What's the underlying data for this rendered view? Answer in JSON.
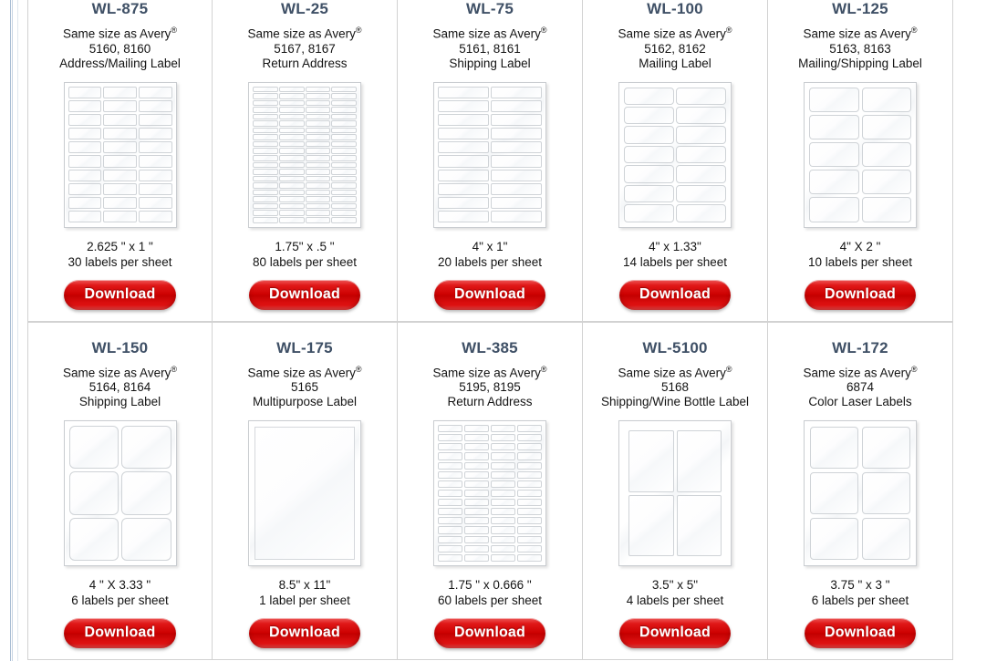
{
  "products": [
    {
      "sku": "WL-875",
      "same_size_as": "Same size as Avery",
      "avery_numbers": "5160, 8160",
      "label_type": "Address/Mailing Label",
      "dimensions": "2.625 \" x 1 \"",
      "count_text": "30 labels per sheet",
      "download_label": "Download",
      "sheet": {
        "cols": 3,
        "rows": 10,
        "gap": 2,
        "radius": "r-sm",
        "pad": 4
      }
    },
    {
      "sku": "WL-25",
      "same_size_as": "Same size as Avery",
      "avery_numbers": "5167, 8167",
      "label_type": "Return Address",
      "dimensions": "1.75\" x .5 \"",
      "count_text": "80 labels per sheet",
      "download_label": "Download",
      "sheet": {
        "cols": 4,
        "rows": 20,
        "gap": 1,
        "radius": "r-sm",
        "pad": 4
      }
    },
    {
      "sku": "WL-75",
      "same_size_as": "Same size as Avery",
      "avery_numbers": "5161, 8161",
      "label_type": "Shipping Label",
      "dimensions": "4\" x 1\"",
      "count_text": "20 labels per sheet",
      "download_label": "Download",
      "sheet": {
        "cols": 2,
        "rows": 10,
        "gap": 2,
        "radius": "r-sm",
        "pad": 4
      }
    },
    {
      "sku": "WL-100",
      "same_size_as": "Same size as Avery",
      "avery_numbers": "5162, 8162",
      "label_type": "Mailing Label",
      "dimensions": "4\" x 1.33\"",
      "count_text": "14 labels per sheet",
      "download_label": "Download",
      "sheet": {
        "cols": 2,
        "rows": 7,
        "gap": 2,
        "radius": "r-md",
        "pad": 5
      }
    },
    {
      "sku": "WL-125",
      "same_size_as": "Same size as Avery",
      "avery_numbers": "5163, 8163",
      "label_type": "Mailing/Shipping Label",
      "dimensions": "4\" X 2 \"",
      "count_text": "10 labels per sheet",
      "download_label": "Download",
      "sheet": {
        "cols": 2,
        "rows": 5,
        "gap": 3,
        "radius": "r-md",
        "pad": 5
      }
    },
    {
      "sku": "WL-150",
      "same_size_as": "Same size as Avery",
      "avery_numbers": "5164, 8164",
      "label_type": "Shipping Label",
      "dimensions": "4 \" X 3.33 \"",
      "count_text": "6 labels per sheet",
      "download_label": "Download",
      "sheet": {
        "cols": 2,
        "rows": 3,
        "gap": 3,
        "radius": "r-lg",
        "pad": 5
      }
    },
    {
      "sku": "WL-175",
      "same_size_as": "Same size as Avery",
      "avery_numbers": "5165",
      "label_type": "Multipurpose Label",
      "dimensions": "8.5\" x 11\"",
      "count_text": "1 label per sheet",
      "download_label": "Download",
      "sheet": {
        "cols": 1,
        "rows": 1,
        "gap": 0,
        "radius": "",
        "pad": 6,
        "single": true
      }
    },
    {
      "sku": "WL-385",
      "same_size_as": "Same size as Avery",
      "avery_numbers": "5195, 8195",
      "label_type": "Return Address",
      "dimensions": "1.75 \" x 0.666 \"",
      "count_text": "60 labels per sheet",
      "download_label": "Download",
      "sheet": {
        "cols": 4,
        "rows": 15,
        "gap": 2,
        "radius": "r-sm",
        "pad": 4
      }
    },
    {
      "sku": "WL-5100",
      "same_size_as": "Same size as Avery",
      "avery_numbers": "5168",
      "label_type": "Shipping/Wine Bottle Label",
      "dimensions": "3.5\" x 5\"",
      "count_text": "4 labels per sheet",
      "download_label": "Download",
      "sheet": {
        "cols": 2,
        "rows": 2,
        "gap": 3,
        "radius": "r-sm",
        "pad": 10
      }
    },
    {
      "sku": "WL-172",
      "same_size_as": "Same size as Avery",
      "avery_numbers": "6874",
      "label_type": "Color Laser Labels",
      "dimensions": "3.75 \" x 3 \"",
      "count_text": "6 labels per sheet",
      "download_label": "Download",
      "sheet": {
        "cols": 2,
        "rows": 3,
        "gap": 4,
        "radius": "r-md",
        "pad": 6
      }
    }
  ],
  "colors": {
    "sku_heading": "#3f5066",
    "download_button": "#cc0000",
    "cell_border": "#d2d2d2",
    "page_rule": "#a9bdd4"
  },
  "registered_mark": "®"
}
